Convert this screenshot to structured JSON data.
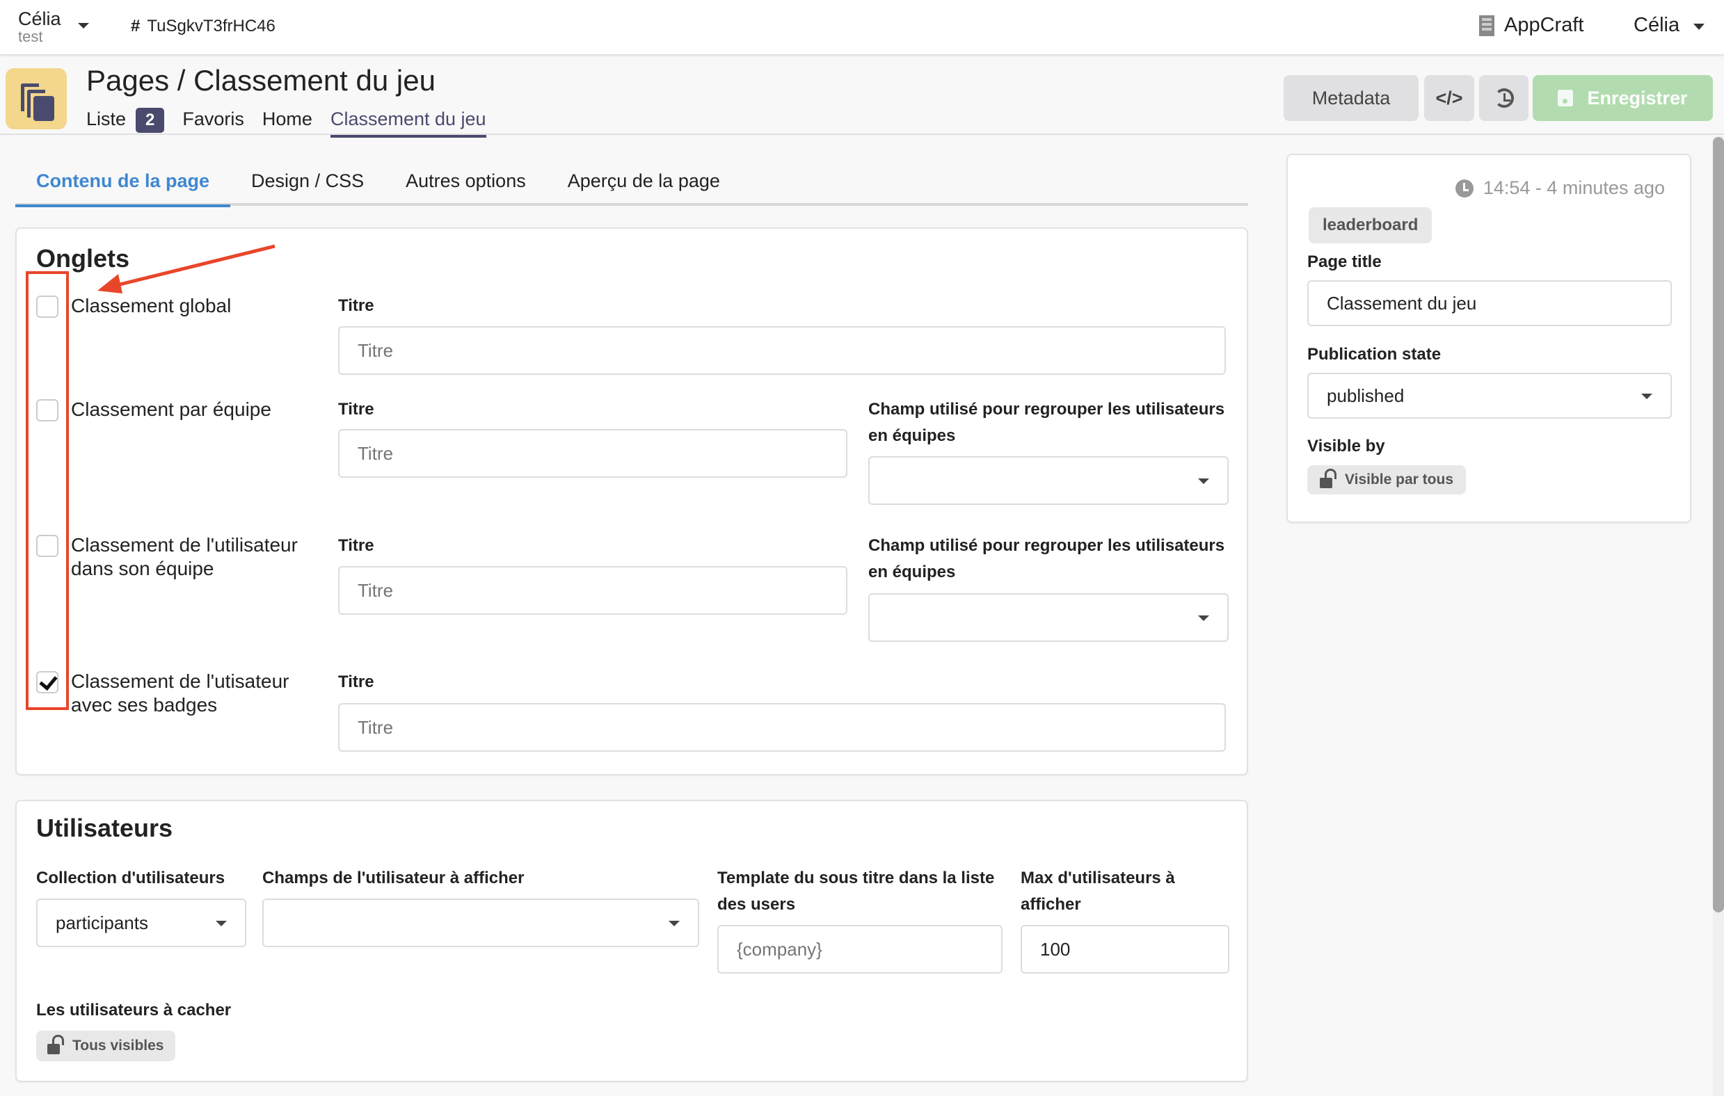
{
  "topbar": {
    "org_name": "Célia",
    "org_sub": "test",
    "app_id_prefix": "#",
    "app_id": "TuSgkvT3frHC46",
    "company": "AppCraft",
    "user": "Célia"
  },
  "header": {
    "title": "Pages / Classement du jeu",
    "subnav": [
      {
        "label": "Liste",
        "badge": "2"
      },
      {
        "label": "Favoris"
      },
      {
        "label": "Home"
      },
      {
        "label": "Classement du jeu",
        "active": true
      }
    ],
    "buttons": {
      "metadata": "Metadata",
      "code": "</>",
      "save": "Enregistrer"
    }
  },
  "tabs": [
    {
      "label": "Contenu de la page",
      "active": true
    },
    {
      "label": "Design / CSS"
    },
    {
      "label": "Autres options"
    },
    {
      "label": "Aperçu de la page"
    }
  ],
  "onglets": {
    "title": "Onglets",
    "items": [
      {
        "label": "Classement global",
        "checked": false,
        "title_label": "Titre",
        "title_placeholder": "Titre",
        "title_value": ""
      },
      {
        "label": "Classement par équipe",
        "checked": false,
        "title_label": "Titre",
        "title_placeholder": "Titre",
        "title_value": "",
        "group_label": "Champ utilisé pour regrouper les utilisateurs en équipes",
        "group_value": ""
      },
      {
        "label": "Classement de l'utilisateur dans son équipe",
        "checked": false,
        "title_label": "Titre",
        "title_placeholder": "Titre",
        "title_value": "",
        "group_label": "Champ utilisé pour regrouper les utilisateurs en équipes",
        "group_value": ""
      },
      {
        "label": "Classement de l'utisateur avec ses badges",
        "checked": true,
        "title_label": "Titre",
        "title_placeholder": "Titre",
        "title_value": ""
      }
    ]
  },
  "users": {
    "title": "Utilisateurs",
    "collection_label": "Collection d'utilisateurs",
    "collection_value": "participants",
    "fields_label": "Champs de l'utilisateur à afficher",
    "fields_value": "",
    "template_label": "Template du sous titre dans la liste des users",
    "template_placeholder": "{company}",
    "max_label": "Max d'utilisateurs à afficher",
    "max_value": "100",
    "hide_label": "Les utilisateurs à cacher",
    "hide_value": "Tous visibles"
  },
  "side": {
    "timestamp": "14:54 - 4 minutes ago",
    "tag": "leaderboard",
    "page_title_label": "Page title",
    "page_title_value": "Classement du jeu",
    "publication_label": "Publication state",
    "publication_value": "published",
    "visible_label": "Visible by",
    "visible_value": "Visible par tous"
  },
  "annotation": {
    "color": "#e8462a"
  },
  "colors": {
    "accent": "#3f87d0",
    "brand": "#4a4a6e",
    "save_disabled": "#b2dcb0",
    "icon_bg": "#f2d78c"
  }
}
